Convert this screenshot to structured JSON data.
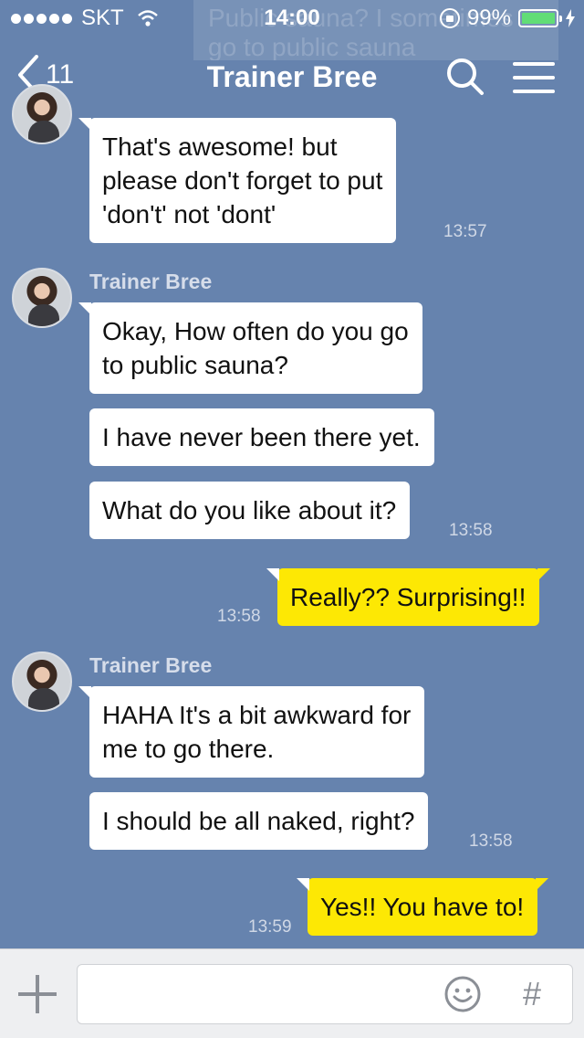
{
  "status_bar": {
    "carrier": "SKT",
    "time": "14:00",
    "battery": "99%",
    "battery_level": 0.99
  },
  "ghost_notification": {
    "text": "Public sauna? I sometimes go to public sauna"
  },
  "nav": {
    "back_count": "11",
    "title": "Trainer Bree"
  },
  "messages": {
    "m0": {
      "text_lines": [
        "That's awesome! but",
        "please don't forget to put",
        "'don't' not 'dont'"
      ],
      "time": "13:57"
    },
    "g1": {
      "sender": "Trainer Bree"
    },
    "m1": {
      "text_lines": [
        "Okay, How often do you go",
        "to public sauna?"
      ]
    },
    "m2": {
      "text": "I have never been there yet."
    },
    "m3": {
      "text": "What do you like about it?",
      "time": "13:58"
    },
    "m4": {
      "text": "Really?? Surprising!!",
      "time": "13:58"
    },
    "g2": {
      "sender": "Trainer Bree"
    },
    "m5": {
      "text_lines": [
        "HAHA It's a bit awkward for",
        "me to go there."
      ]
    },
    "m6": {
      "text": "I should be all naked, right?",
      "time": "13:58"
    },
    "m7": {
      "text": "Yes!! You have to!",
      "time": "13:59"
    }
  },
  "input_bar": {
    "placeholder": "",
    "hash_label": "#"
  },
  "colors": {
    "chat_background": "#6683ae",
    "my_bubble": "#fde804",
    "their_bubble": "#ffffff",
    "input_bar": "#eeeff1"
  },
  "icons": [
    "back-chevron-icon",
    "search-icon",
    "menu-icon",
    "plus-icon",
    "emoji-icon",
    "hash-icon",
    "wifi-icon",
    "rotation-lock-icon",
    "battery-icon",
    "charging-bolt-icon"
  ]
}
